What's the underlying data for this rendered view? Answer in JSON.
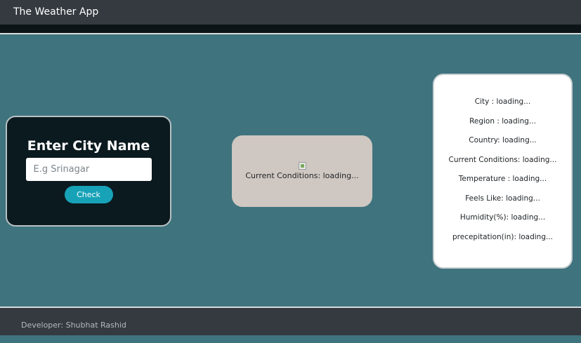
{
  "navbar": {
    "title": "The Weather App"
  },
  "search": {
    "heading": "Enter City Name",
    "placeholder": "E.g Srinagar",
    "value": "",
    "button_label": "Check"
  },
  "conditions_card": {
    "icon": "broken-image-icon",
    "text": "Current Conditions: loading..."
  },
  "info": {
    "city": "City : loading...",
    "region": "Region : loading...",
    "country": "Country: loading...",
    "conditions": "Current Conditions: loading...",
    "temperature": "Temperature : loading...",
    "feels_like": "Feels Like: loading...",
    "humidity": "Humidity(%): loading...",
    "precipitation": "precepitation(in): loading..."
  },
  "footer": {
    "text": "Developer: Shubhat Rashid"
  },
  "colors": {
    "navbar": "#343a40",
    "background": "#3f737e",
    "search_card": "#0b1a1f",
    "accent": "#17a2b8",
    "conditions_card": "#cfc7c1"
  }
}
